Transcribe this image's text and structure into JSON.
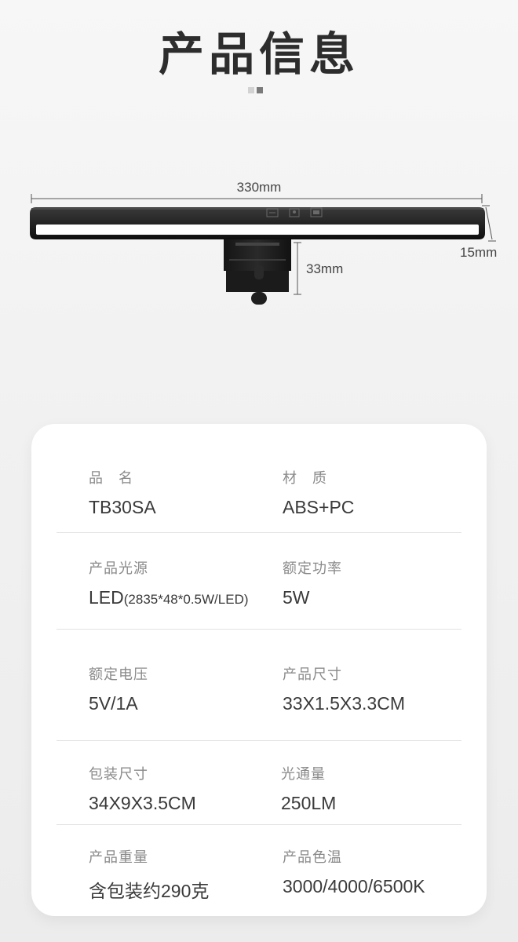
{
  "header": {
    "title": "产品信息"
  },
  "dimensions": {
    "width": "330mm",
    "depth": "15mm",
    "height": "33mm"
  },
  "lamp_controls": [
    "ambient-light-button",
    "mode-button",
    "monitor-light-button"
  ],
  "specs": [
    [
      {
        "label": "品　名",
        "value": "TB30SA"
      },
      {
        "label": "材　质",
        "value": "ABS+PC"
      }
    ],
    [
      {
        "label": "产品光源",
        "value": "LED",
        "value_sub": "(2835*48*0.5W/LED)"
      },
      {
        "label": "额定功率",
        "value": "5W"
      }
    ],
    [
      {
        "label": "额定电压",
        "value": "5V/1A"
      },
      {
        "label": "产品尺寸",
        "value": "33X1.5X3.3CM"
      }
    ],
    [
      {
        "label": "包装尺寸",
        "value": "34X9X3.5CM"
      },
      {
        "label": "光通量",
        "value": "250LM"
      }
    ],
    [
      {
        "label": "产品重量",
        "value": "含包装约290克"
      },
      {
        "label": "产品色温",
        "value": "3000/4000/6500K"
      }
    ]
  ],
  "colors": {
    "background": "#f2f2f2",
    "card": "#ffffff",
    "title": "#2d2d2d",
    "label": "#8a8a8a",
    "value": "#3a3a3a",
    "lamp": "#1a1a1a",
    "light": "#ffffff"
  }
}
